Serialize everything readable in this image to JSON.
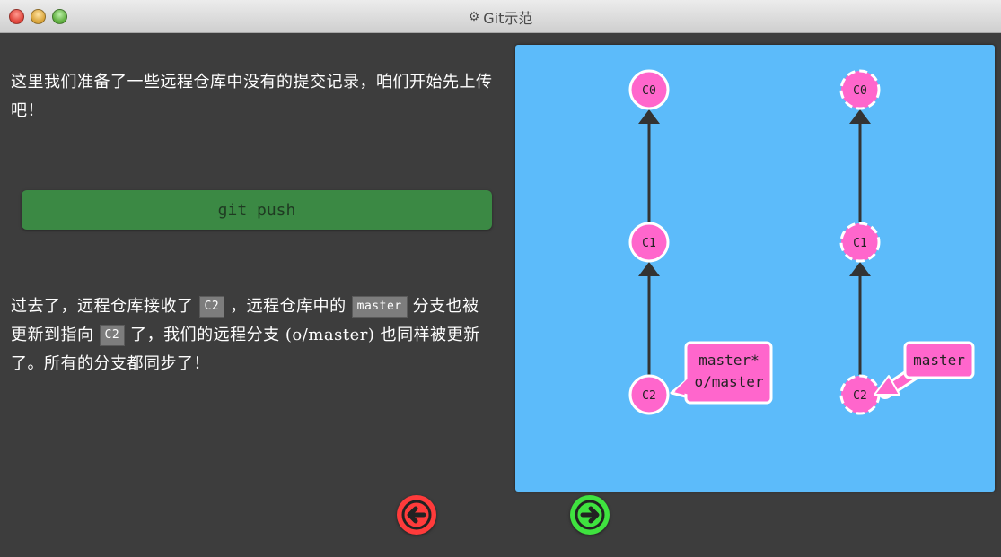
{
  "window": {
    "title": "Git示范",
    "gear_icon": "⚙"
  },
  "text": {
    "intro": "这里我们准备了一些远程仓库中没有的提交记录，咱们开始先上传吧！",
    "command": "git push",
    "result_part1": "过去了，远程仓库接收了",
    "result_code1": "C2",
    "result_part2": "，远程仓库中的",
    "result_code2": "master",
    "result_part3": "分支也被更新到指向",
    "result_code3": "C2",
    "result_part4": "了，我们的远程分支 (o/master) 也同样被更新了。所有的分支都同步了！"
  },
  "graph": {
    "local": {
      "commits": [
        "C0",
        "C1",
        "C2"
      ],
      "branch_label_1": "master*",
      "branch_label_2": "o/master"
    },
    "remote": {
      "commits": [
        "C0",
        "C1",
        "C2"
      ],
      "branch_label": "master"
    }
  },
  "nav": {
    "back_icon": "arrow-left-icon",
    "forward_icon": "arrow-right-icon"
  },
  "colors": {
    "commit": "#ff66cc",
    "visualization_bg": "#5cbbfa",
    "back": "#ff3b3b",
    "forward": "#3fe23f",
    "command_bg": "#3b8944"
  }
}
